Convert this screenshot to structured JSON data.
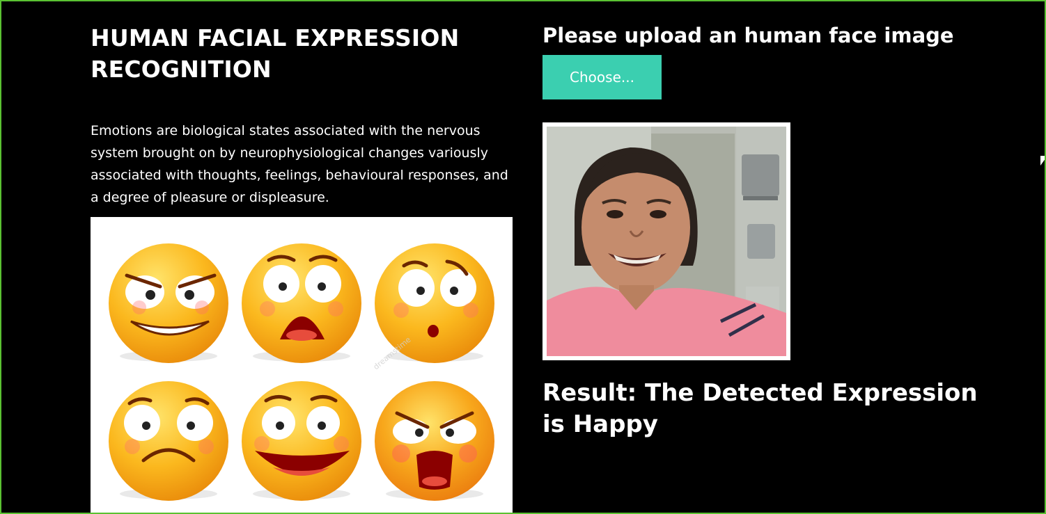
{
  "app": {
    "title": "HUMAN FACIAL EXPRESSION RECOGNITION",
    "description": "Emotions are biological states associated with the nervous system brought on by neurophysiological changes variously associated with thoughts, feelings, behavioural responses, and a degree of pleasure or displeasure."
  },
  "upload": {
    "heading": "Please upload an human face image",
    "button_label": "Choose..."
  },
  "result": {
    "text": "Result: The Detected Expression is Happy"
  },
  "illustration": {
    "watermark": "dreamstime",
    "emojis": [
      "angry-grin",
      "shocked",
      "surprised",
      "sad",
      "laughing",
      "furious-shouting"
    ]
  },
  "colors": {
    "background": "#000000",
    "frame_border": "#5ac232",
    "button": "#3bcfb0",
    "text": "#ffffff"
  }
}
